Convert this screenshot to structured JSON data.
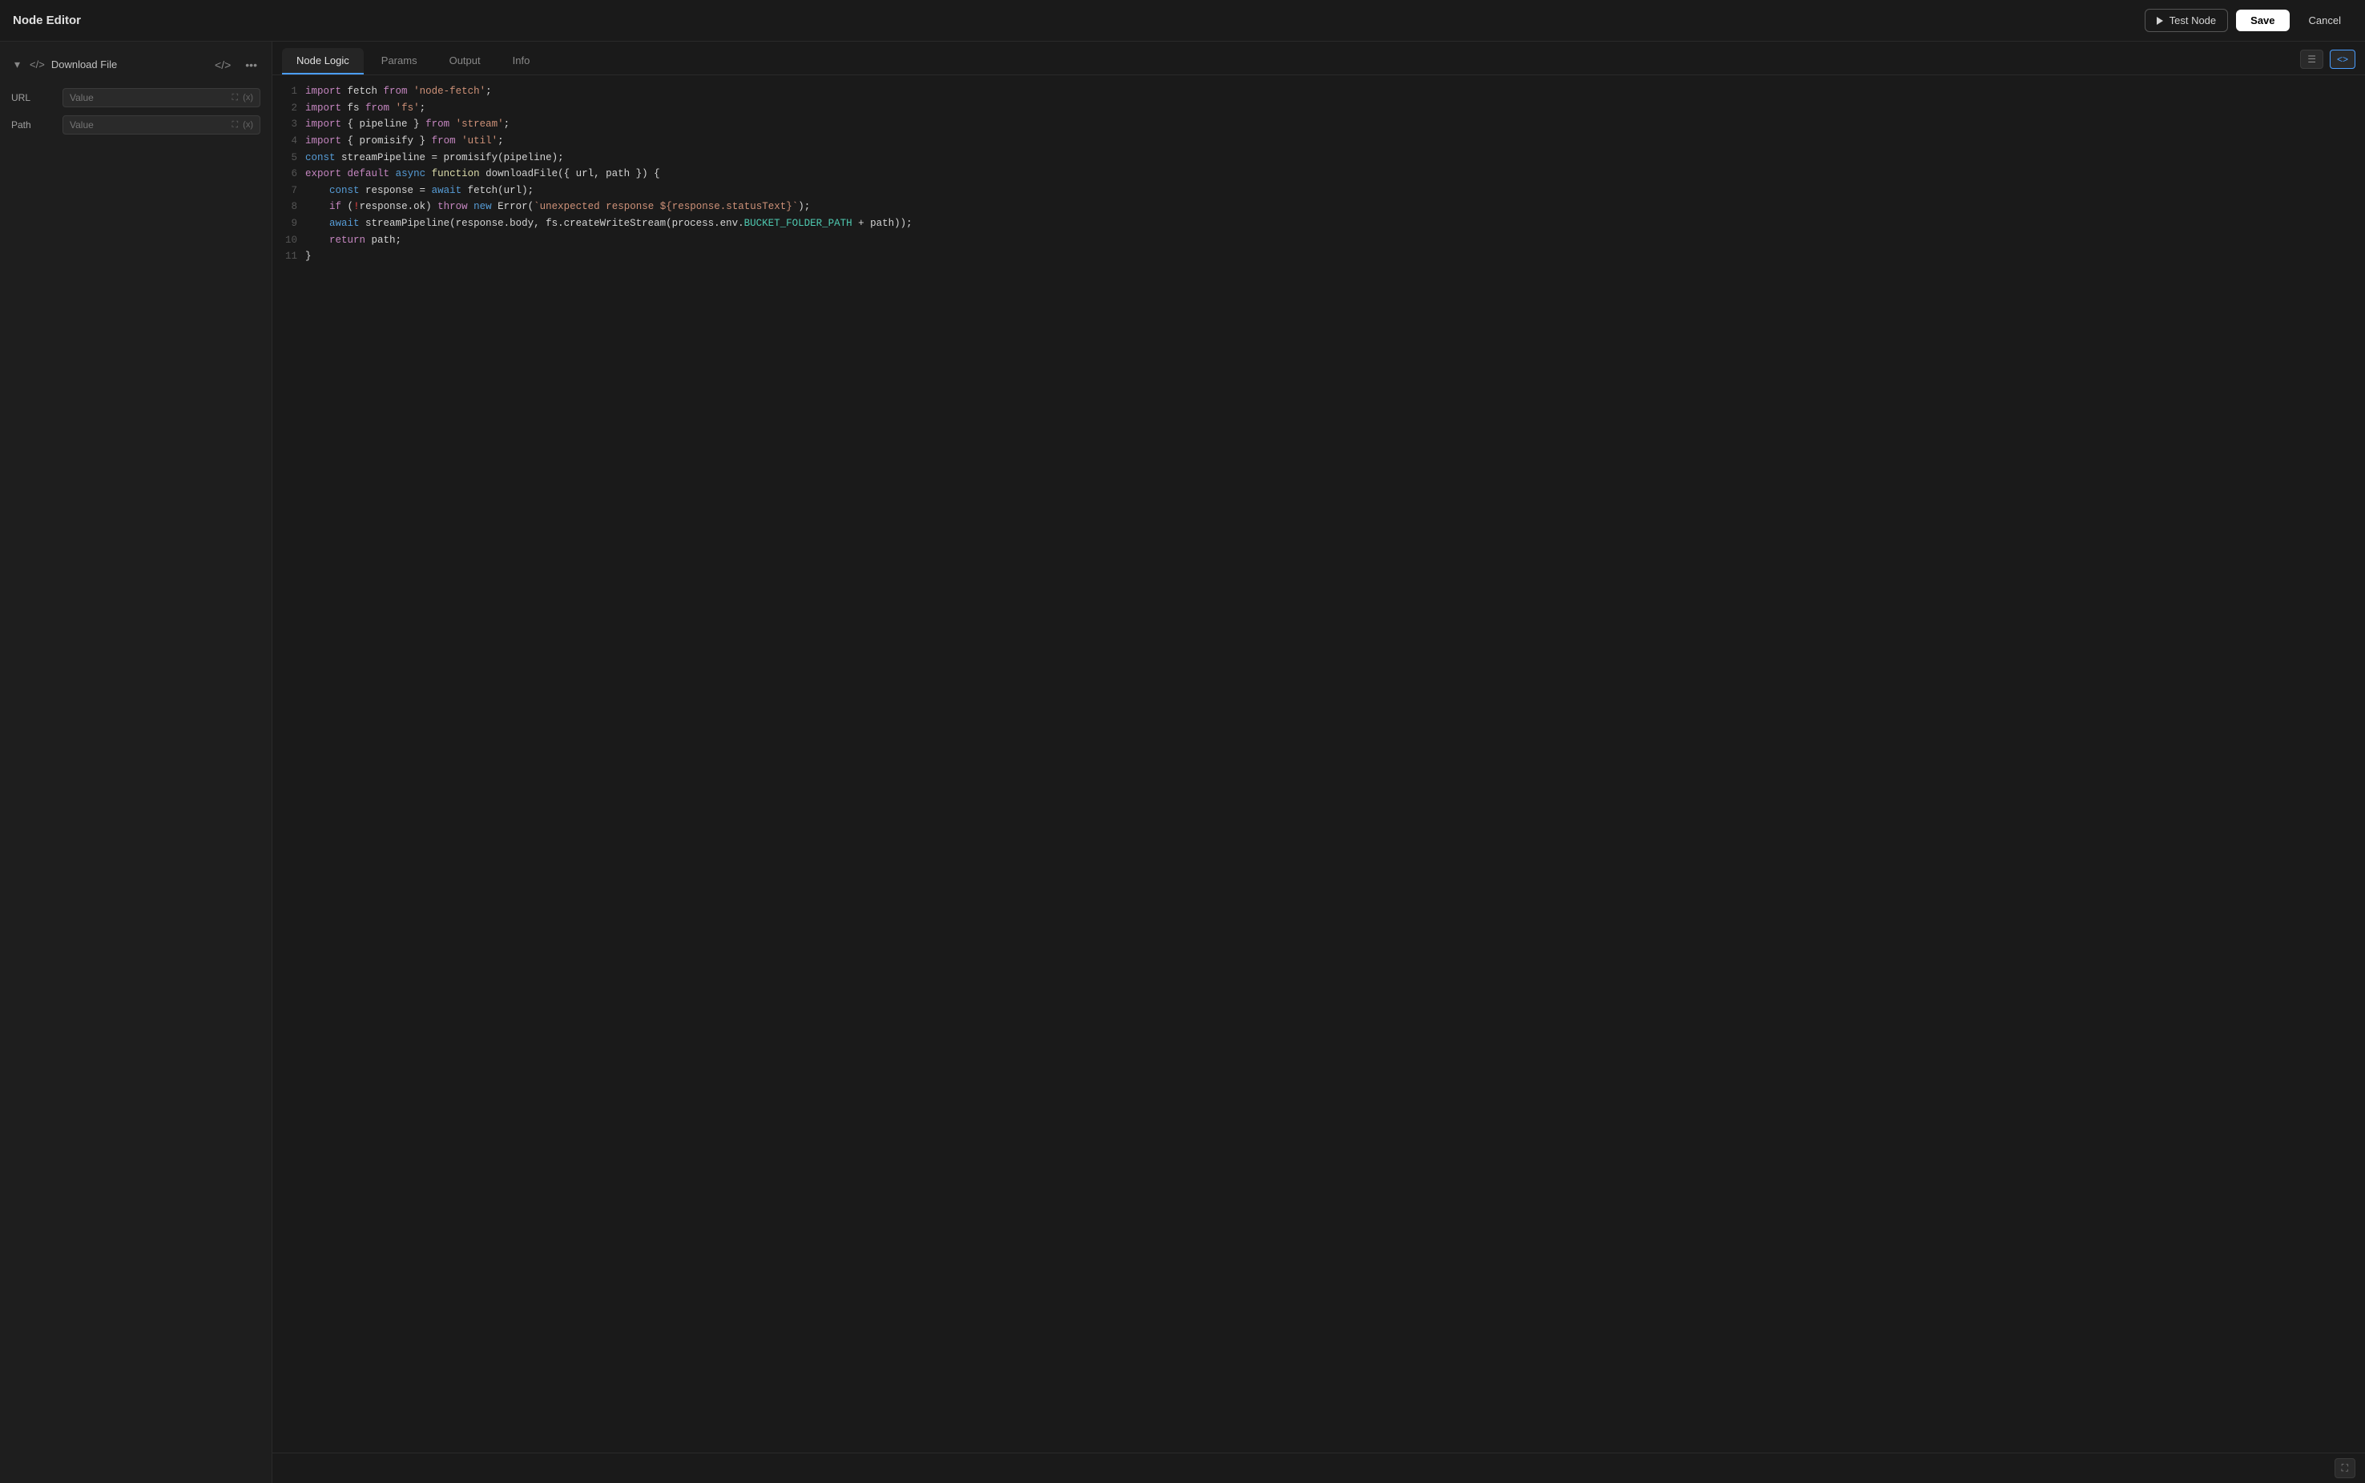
{
  "app": {
    "title": "Node Editor"
  },
  "header": {
    "title": "Node Editor",
    "test_node_label": "Test Node",
    "save_label": "Save",
    "cancel_label": "Cancel"
  },
  "sidebar": {
    "node_name": "Download File",
    "params": [
      {
        "label": "URL",
        "placeholder": "Value"
      },
      {
        "label": "Path",
        "placeholder": "Value"
      }
    ]
  },
  "tabs": [
    {
      "id": "node-logic",
      "label": "Node Logic",
      "active": true
    },
    {
      "id": "params",
      "label": "Params",
      "active": false
    },
    {
      "id": "output",
      "label": "Output",
      "active": false
    },
    {
      "id": "info",
      "label": "Info",
      "active": false
    }
  ],
  "code": {
    "lines": [
      {
        "num": 1,
        "html": "<span class='kw-import'>import</span> fetch <span class='kw-from'>from</span> <span class='str'>'node-fetch'</span>;"
      },
      {
        "num": 2,
        "html": "<span class='kw-import'>import</span> fs <span class='kw-from'>from</span> <span class='str'>'fs'</span>;"
      },
      {
        "num": 3,
        "html": "<span class='kw-import'>import</span> { pipeline } <span class='kw-from'>from</span> <span class='str'>'stream'</span>;"
      },
      {
        "num": 4,
        "html": "<span class='kw-import'>import</span> { promisify } <span class='kw-from'>from</span> <span class='str'>'util'</span>;"
      },
      {
        "num": 5,
        "html": "<span class='kw-const'>const</span> streamPipeline = promisify(pipeline);"
      },
      {
        "num": 6,
        "html": "<span class='kw-export'>export</span> <span class='kw-default'>default</span> <span class='kw-async'>async</span> <span class='kw-function'>function</span> downloadFile({ url, path }) {"
      },
      {
        "num": 7,
        "html": "    <span class='kw-const'>const</span> response = <span class='kw-await'>await</span> fetch(url);"
      },
      {
        "num": 8,
        "html": "    <span class='kw-if'>if</span> (<span class='exclamation'>!</span>response.ok) <span class='kw-throw'>throw</span> <span class='kw-new'>new</span> Error(<span class='str'>`unexpected response ${response.statusText}`</span>);"
      },
      {
        "num": 9,
        "html": "    <span class='kw-await'>await</span> streamPipeline(response.body, fs.createWriteStream(process.env.<span class='env-name'>BUCKET_FOLDER_PATH</span> + path));"
      },
      {
        "num": 10,
        "html": "    <span class='kw-return'>return</span> path;"
      },
      {
        "num": 11,
        "html": "}"
      }
    ]
  }
}
